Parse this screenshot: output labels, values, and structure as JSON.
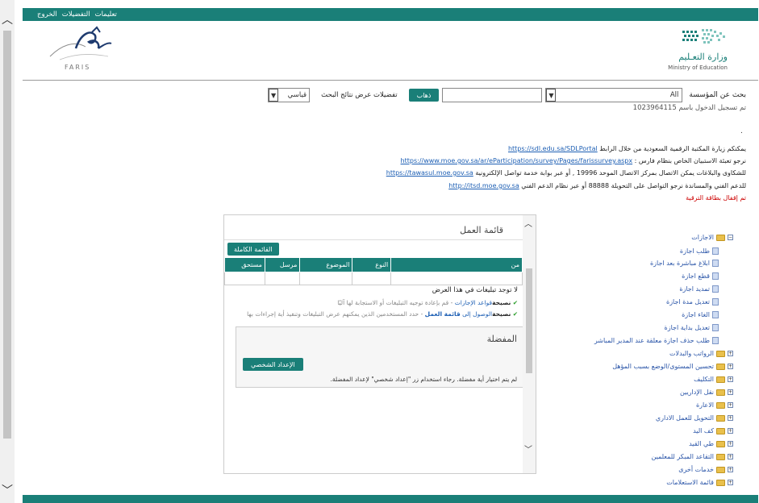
{
  "top_links": [
    "تعليمات",
    "التفضيلات",
    "الخروج"
  ],
  "header": {
    "faris_logo_text": "FARIS",
    "moe_title": "وزارة التعـليم",
    "moe_subtitle": "Ministry of Education"
  },
  "search": {
    "label": "بحث عن المؤسسة",
    "institution_value": "All",
    "go_button": "ذهاب",
    "results_label": "تفضيلات عرض نتائج البحث",
    "display_value": "قياسي"
  },
  "login_info": "تم تسجيل الدخول باسم 1023964115",
  "dot": ".",
  "info_lines": {
    "l1_text": "يمكنكم زيارة المكتبة الرقمية السعودية من خلال الرابط",
    "l1_link": "https://sdl.edu.sa/SDLPortal",
    "l2_text": "نرجو تعبئة الاستبيان الخاص بنظام فارس :",
    "l2_link": "https://www.moe.gov.sa/ar/eParticipation/survey/Pages/farissurvey.aspx",
    "l3_text_a": "للشكاوى والبلاغات يمكن الاتصال بمركز الاتصال الموحد 19996 , أو عبر بوابة خدمة تواصل الإلكترونية",
    "l3_link": "https://tawasul.moe.gov.sa",
    "l4_text_a": "للدعم الفني والمساندة نرجو التواصل على التحويلة 88888 أو عبر نظام الدعم الفني",
    "l4_link": "http://itsd.moe.gov.sa",
    "warning": "تم إقفال بطاقة الترقية"
  },
  "tree": {
    "root": "الاجازات",
    "leaves": [
      "طلب اجازة",
      "ابلاغ مباشرة بعد اجازة",
      "قطع اجازة",
      "تمديد اجازة",
      "تعديل مدة اجازة",
      "الغاء اجازة",
      "تعديل بداية اجازة",
      "طلب حذف اجازة معلقة عند المدير المباشر"
    ],
    "folders": [
      "الرواتب والبدلات",
      "تحسين المستوى/الوضع بسبب المؤهل",
      "التكليف",
      "نقل الإداريين",
      "الاعارة",
      "التحويل للعمل الاداري",
      "كف اليد",
      "طي القيد",
      "التقاعد المبكر للمعلمين",
      "خدمات أخرى",
      "قائمة الاستعلامات"
    ]
  },
  "worklist": {
    "title": "قائمة العمل",
    "fixed_list_button": "القائمة الكاملة",
    "columns": [
      "من",
      "النوع",
      "الموضوع",
      "مرسل",
      "مستحق"
    ],
    "empty_message": "لا توجد تبليغات في هذا العرض",
    "tip1_bold": "نصيحة",
    "tip1_link": "قواعد الإجازات",
    "tip1_rest": " - قم بإعادة توجيه التبليغات أو الاستجابة لها آليًا",
    "tip2_bold": "نصيحة",
    "tip2_text_a": "الوصول إلى ",
    "tip2_link": "قائمة العمل",
    "tip2_rest": " - حدد المستخدمين الذين يمكنهم عرض التبليغات وتنفيذ أية إجراءات بها"
  },
  "favorites": {
    "title": "المفضلة",
    "personal_button": "الإعداد الشخصي",
    "note": "لم يتم اختيار أية مفضلة. رجاء استخدام زر \"إعداد شخصي\" لإعداد المفضلة."
  },
  "colors": {
    "brand": "#1a7f78",
    "link": "#1d5fb4",
    "warning": "#cc0000"
  }
}
